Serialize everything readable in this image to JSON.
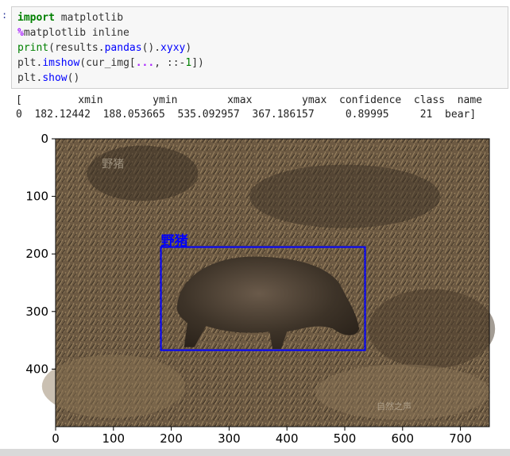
{
  "cell": {
    "prompt": ":",
    "code_lines": [
      {
        "parts": [
          {
            "t": "import",
            "c": "kw"
          },
          {
            "t": " matplotlib",
            "c": ""
          }
        ]
      },
      {
        "parts": [
          {
            "t": "%",
            "c": "mg"
          },
          {
            "t": "matplotlib inline",
            "c": ""
          }
        ]
      },
      {
        "parts": [
          {
            "t": "print",
            "c": "bi"
          },
          {
            "t": "(results.",
            "c": ""
          },
          {
            "t": "pandas",
            "c": "at"
          },
          {
            "t": "().",
            "c": ""
          },
          {
            "t": "xyxy",
            "c": "at"
          },
          {
            "t": ")",
            "c": ""
          }
        ]
      },
      {
        "parts": [
          {
            "t": "plt.",
            "c": ""
          },
          {
            "t": "imshow",
            "c": "at"
          },
          {
            "t": "(cur_img[",
            "c": ""
          },
          {
            "t": "...",
            "c": "mg"
          },
          {
            "t": ", ::-",
            "c": ""
          },
          {
            "t": "1",
            "c": "num"
          },
          {
            "t": "])",
            "c": ""
          }
        ]
      },
      {
        "parts": [
          {
            "t": "plt.",
            "c": ""
          },
          {
            "t": "show",
            "c": "at"
          },
          {
            "t": "()",
            "c": ""
          }
        ]
      }
    ]
  },
  "output": {
    "header_line": "[         xmin        ymin        xmax        ymax  confidence  class  name",
    "row_line": "0  182.12442  188.053665  535.092957  367.186157     0.89995     21  bear]"
  },
  "chart_data": {
    "type": "image",
    "xlim": [
      0,
      750
    ],
    "ylim": [
      500,
      0
    ],
    "xticks": [
      0,
      100,
      200,
      300,
      400,
      500,
      600,
      700
    ],
    "yticks": [
      0,
      100,
      200,
      300,
      400
    ],
    "bbox": {
      "xmin": 182.12442,
      "ymin": 188.053665,
      "xmax": 535.092957,
      "ymax": 367.186157,
      "label": "野猪",
      "color": "#0000ff"
    },
    "watermarks": [
      "野猪",
      "自然之声"
    ]
  }
}
